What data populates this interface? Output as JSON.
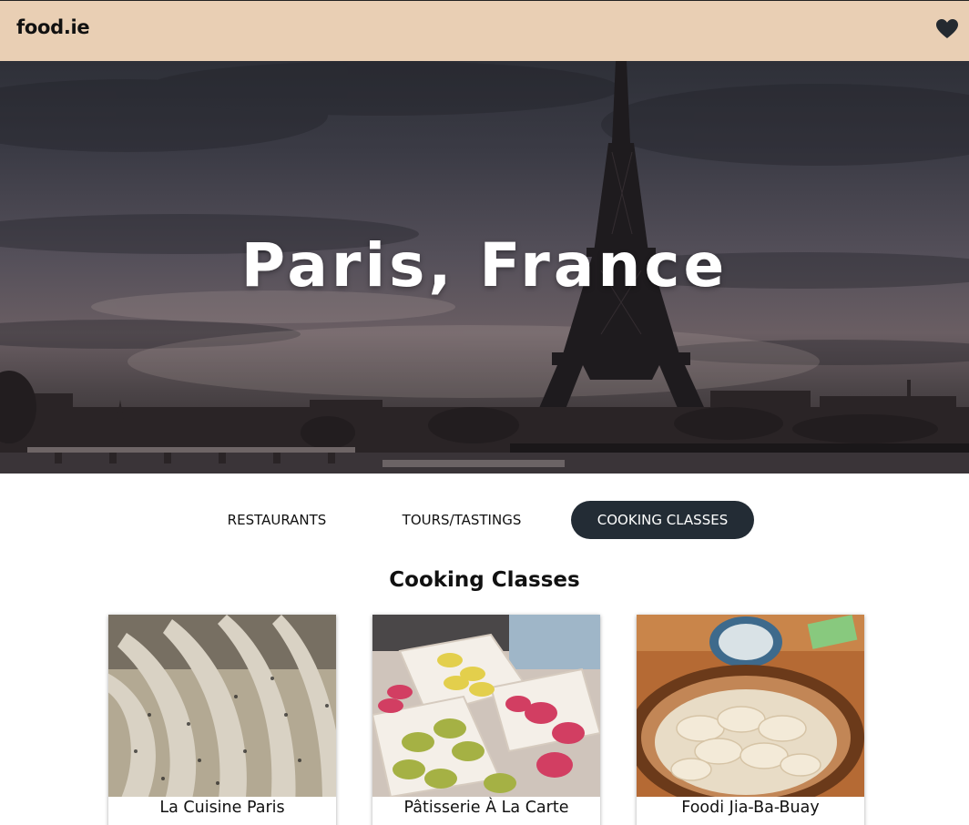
{
  "header": {
    "logo": "food.ie",
    "favorites_icon": "heart-icon"
  },
  "hero": {
    "title": "Paris, France"
  },
  "tabs": [
    {
      "label": "RESTAURANTS",
      "active": false
    },
    {
      "label": "TOURS/TASTINGS",
      "active": false
    },
    {
      "label": "COOKING CLASSES",
      "active": true
    }
  ],
  "section": {
    "title": "Cooking Classes"
  },
  "cards": [
    {
      "name": "La Cuisine Paris"
    },
    {
      "name": "Pâtisserie À La Carte"
    },
    {
      "name": "Foodi Jia-Ba-Buay"
    }
  ],
  "colors": {
    "header_bg": "#e9cfb4",
    "active_tab_bg": "#232c35",
    "active_tab_text": "#ffffff"
  }
}
